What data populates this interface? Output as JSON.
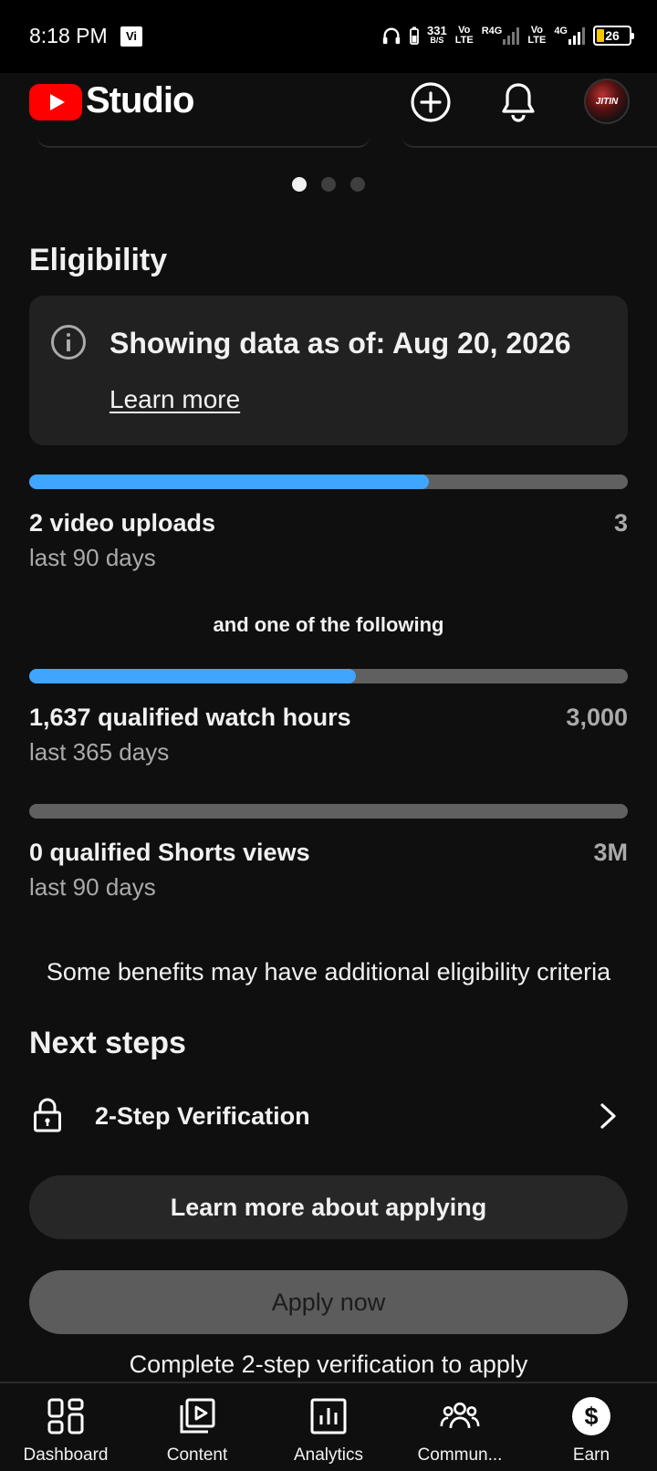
{
  "status_bar": {
    "time": "8:18 PM",
    "carrier_badge": "Vi",
    "net_speed_value": "331",
    "net_speed_unit": "B/S",
    "volte1_top": "Vo",
    "volte1_bottom": "LTE",
    "network1": "R4G",
    "volte2_top": "Vo",
    "volte2_bottom": "LTE",
    "network2": "4G",
    "battery": "26",
    "icons": [
      "headphones-icon",
      "battery-saver-icon",
      "signal-icon",
      "battery-icon"
    ]
  },
  "header": {
    "brand": "Studio",
    "icons": [
      "youtube-logo-icon",
      "create-plus-icon",
      "notifications-bell-icon",
      "avatar"
    ],
    "avatar_text": "JITIN"
  },
  "carousel": {
    "dots": 3,
    "active": 0
  },
  "eligibility": {
    "title": "Eligibility",
    "info_text": "Showing data as of: Aug 20, 2026",
    "learn_more": "Learn more",
    "uploads": {
      "label": "2 video uploads",
      "sub": "last 90 days",
      "goal": "3",
      "progress": 0.667
    },
    "or_label": "and one of the following",
    "watch_hours": {
      "label": "1,637 qualified watch hours",
      "sub": "last 365 days",
      "goal": "3,000",
      "progress": 0.546
    },
    "shorts": {
      "label": "0 qualified Shorts views",
      "sub": "last 90 days",
      "goal": "3M",
      "progress": 0
    },
    "note": "Some benefits may have additional eligibility criteria"
  },
  "next_steps": {
    "title": "Next steps",
    "step_label": "2-Step Verification",
    "learn_button": "Learn more about applying",
    "apply_button": "Apply now",
    "footnote": "Complete 2-step verification to apply"
  },
  "colors": {
    "accent": "#3ea6ff",
    "brand_red": "#ff0000",
    "background": "#0f0f0f",
    "card": "#212121"
  },
  "bottom_nav": [
    {
      "label": "Dashboard",
      "icon": "dashboard-icon"
    },
    {
      "label": "Content",
      "icon": "content-icon"
    },
    {
      "label": "Analytics",
      "icon": "analytics-icon"
    },
    {
      "label": "Commun...",
      "icon": "community-icon"
    },
    {
      "label": "Earn",
      "icon": "earn-icon",
      "active": true
    }
  ]
}
